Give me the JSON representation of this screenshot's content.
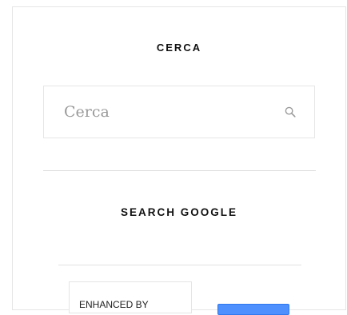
{
  "search_widget": {
    "title": "CERCA",
    "input_placeholder": "Cerca",
    "input_value": "",
    "icon": "search-icon"
  },
  "google_widget": {
    "title": "SEARCH GOOGLE",
    "branding_label": "ENHANCED BY",
    "button_color": "#4d90fe"
  }
}
